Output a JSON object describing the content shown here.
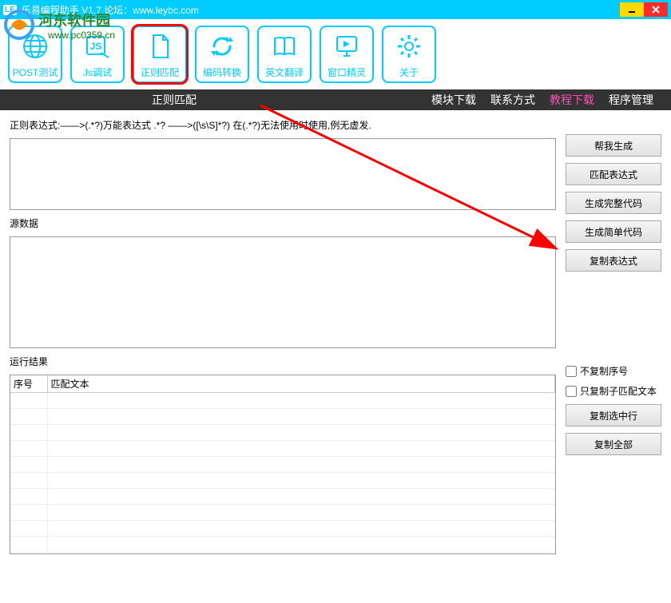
{
  "titlebar": {
    "icon_text": "LE",
    "title": "乐易编程助手  V1.7 论坛：www.leybc.com"
  },
  "watermark": {
    "brand": "河东软件园",
    "url": "www.pc0359.cn"
  },
  "toolbar": {
    "items": [
      {
        "name": "post-test",
        "label": "POST测试"
      },
      {
        "name": "js-debug",
        "label": "Js调试"
      },
      {
        "name": "regex-match",
        "label": "正则匹配"
      },
      {
        "name": "encoding",
        "label": "编码转换"
      },
      {
        "name": "translate",
        "label": "英文翻译"
      },
      {
        "name": "window-spirit",
        "label": "窗口精灵"
      },
      {
        "name": "about",
        "label": "关于"
      }
    ]
  },
  "navbar": {
    "center": "正则匹配",
    "links": [
      {
        "name": "module-download",
        "label": "模块下载"
      },
      {
        "name": "contact",
        "label": "联系方式"
      },
      {
        "name": "tutorial-download",
        "label": "教程下载",
        "pink": true
      },
      {
        "name": "program-manage",
        "label": "程序管理"
      }
    ]
  },
  "labels": {
    "regex": "正则表达式:——>(.*?)万能表达式  .*?  ——>([\\s\\S]*?)     在(.*?)无法使用时使用,例无虚发.",
    "source": "源数据",
    "results": "运行结果"
  },
  "inputs": {
    "regex_value": "",
    "source_value": ""
  },
  "side_buttons": {
    "help_gen": "帮我生成",
    "match_expr": "匹配表达式",
    "gen_full": "生成完整代码",
    "gen_simple": "生成简单代码",
    "copy_expr": "复制表达式",
    "copy_selected": "复制选中行",
    "copy_all": "复制全部"
  },
  "checkboxes": {
    "no_copy_seq": "不复制序号",
    "only_copy_sub": "只复制子匹配文本"
  },
  "table": {
    "col_seq": "序号",
    "col_text": "匹配文本"
  }
}
